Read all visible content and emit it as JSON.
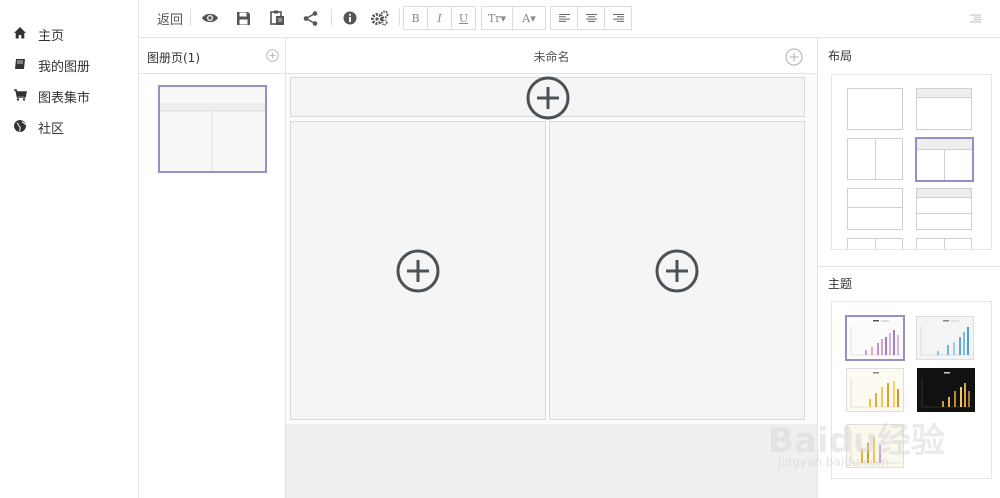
{
  "nav": {
    "items": [
      {
        "label": "主页",
        "icon": "home-icon"
      },
      {
        "label": "我的图册",
        "icon": "book-icon"
      },
      {
        "label": "图表集市",
        "icon": "cart-icon"
      },
      {
        "label": "社区",
        "icon": "globe-icon"
      }
    ]
  },
  "toolbar": {
    "back_label": "返回",
    "bold_label": "B",
    "italic_label": "I",
    "underline_label": "U",
    "text_size_label": "Tr▾",
    "font_color_label": "A▾"
  },
  "pages_panel": {
    "title": "图册页(1)"
  },
  "editor": {
    "doc_title": "未命名"
  },
  "right_panel": {
    "layout_title": "布局",
    "theme_title": "主题"
  },
  "watermark": {
    "text": "Baidu经验",
    "sub": "jingyan.baidu.com"
  },
  "colors": {
    "accent": "#9b8dc8",
    "icon_dark": "#4a5257",
    "border": "#e3e3e3"
  }
}
